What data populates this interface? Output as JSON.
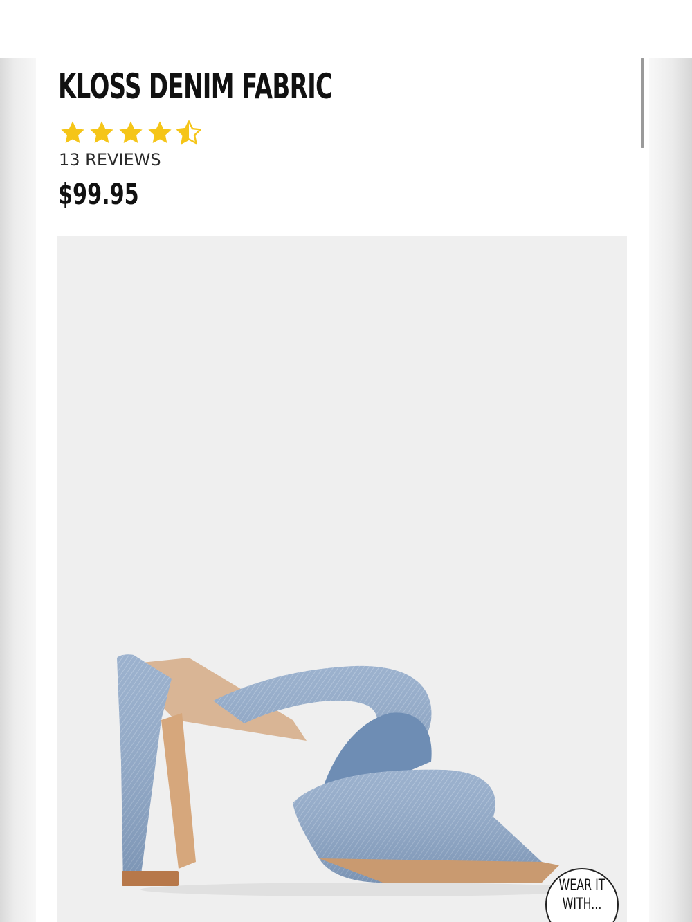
{
  "product": {
    "title": "KLOSS DENIM FABRIC",
    "rating": 4.5,
    "rating_max": 5,
    "reviews_label": "13 REVIEWS",
    "price": "$99.95",
    "image_icon": "denim-heel-sandal-image"
  },
  "wear_it_with": {
    "line1": "WEAR IT",
    "line2": "WITH..."
  },
  "colors": {
    "star": "#f5c518",
    "text": "#111111",
    "image_bg": "#efefef",
    "denim": "#8ea7c7"
  }
}
